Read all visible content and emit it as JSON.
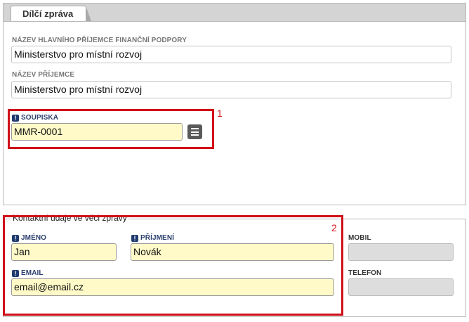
{
  "tab": {
    "label": "Dílčí zpráva"
  },
  "section1": {
    "main_recipient": {
      "label": "NÁZEV HLAVNÍHO PŘÍJEMCE FINANČNÍ PODPORY",
      "value": "Ministerstvo pro místní rozvoj"
    },
    "recipient": {
      "label": "NÁZEV PŘÍJEMCE",
      "value": "Ministerstvo pro místní rozvoj"
    },
    "soupiska": {
      "label": "SOUPISKA",
      "value": "MMR-0001"
    },
    "highlight_number": "1"
  },
  "section2": {
    "legend": "Kontaktní údaje ve věci zprávy",
    "highlight_number": "2",
    "first_name": {
      "label": "JMÉNO",
      "value": "Jan"
    },
    "last_name": {
      "label": "PŘÍJMENÍ",
      "value": "Novák"
    },
    "email": {
      "label": "EMAIL",
      "value": "email@email.cz"
    },
    "mobile": {
      "label": "MOBIL",
      "value": ""
    },
    "phone": {
      "label": "TELEFON",
      "value": ""
    }
  },
  "colors": {
    "required_field": "#fffac8",
    "highlight": "#d0101a",
    "required_icon": "#1f3a6e"
  }
}
